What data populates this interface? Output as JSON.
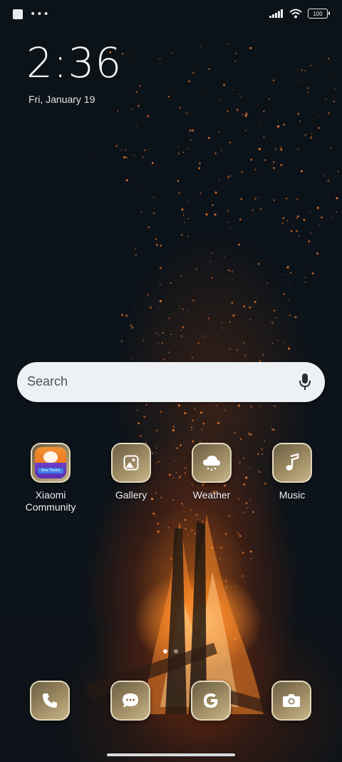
{
  "status_bar": {
    "left_icons": [
      "notification-square-icon",
      "more-dots-icon"
    ],
    "more_dots": "•••",
    "signal": "signal-icon",
    "wifi": "wifi-icon",
    "battery_level": "100"
  },
  "lockclock": {
    "time": "2:36",
    "date": "Fri, January 19"
  },
  "search": {
    "placeholder": "Search",
    "mic_icon": "mic-icon"
  },
  "apps": [
    {
      "label": "Xiaomi\nCommunity",
      "icon": "xiaomi-community-icon",
      "badge_text": "New Theme"
    },
    {
      "label": "Gallery",
      "icon": "gallery-icon"
    },
    {
      "label": "Weather",
      "icon": "weather-icon"
    },
    {
      "label": "Music",
      "icon": "music-icon"
    }
  ],
  "pager": {
    "pages": 2,
    "current": 1
  },
  "dock": [
    {
      "name": "Phone",
      "icon": "phone-icon"
    },
    {
      "name": "Messages",
      "icon": "messages-icon"
    },
    {
      "name": "Google",
      "icon": "google-icon"
    },
    {
      "name": "Camera",
      "icon": "camera-icon"
    }
  ],
  "colors": {
    "background": "#0c131a",
    "icon_gold": "#b39f72",
    "search_bg": "#eef1f3"
  }
}
